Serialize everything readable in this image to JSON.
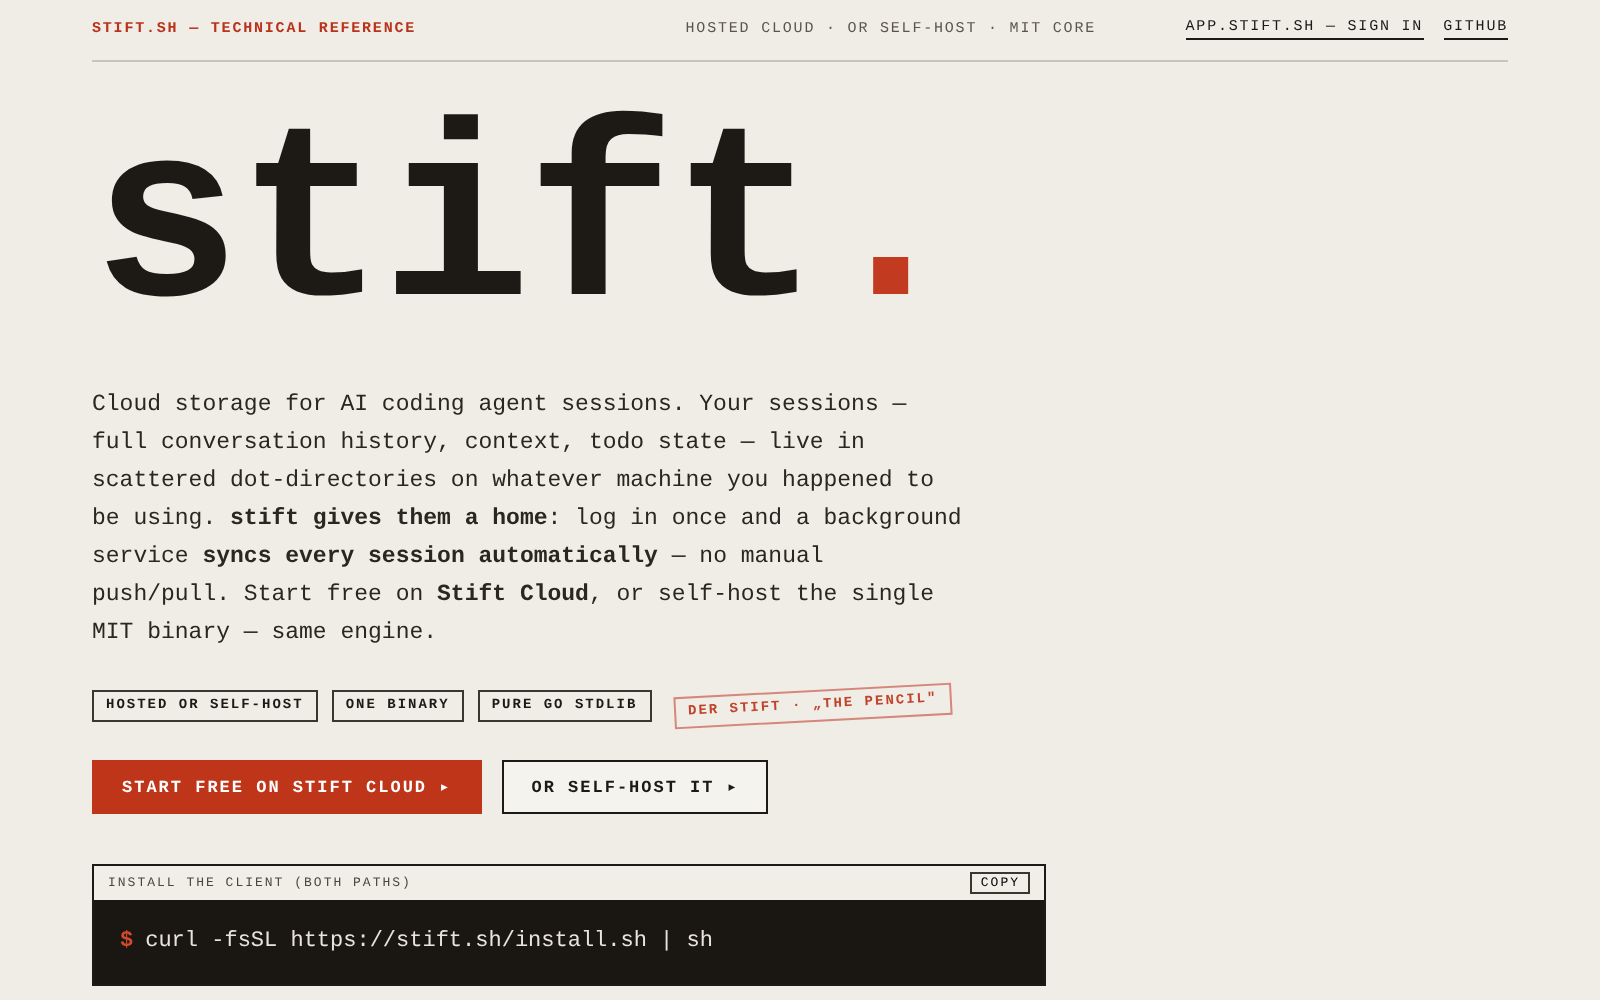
{
  "header": {
    "brand": "STIFT.SH — TECHNICAL REFERENCE",
    "tagline": "HOSTED CLOUD · OR SELF-HOST · MIT CORE",
    "links": [
      {
        "label": "APP.STIFT.SH — SIGN IN"
      },
      {
        "label": "GITHUB"
      }
    ]
  },
  "hero": {
    "title": "stift",
    "title_mark": ".",
    "intro": "Cloud storage for AI coding agent sessions. Your sessions — full conversation history, context, todo state — live in scattered dot-directories on whatever machine you happened to be using. **stift gives them a home**: log in once and a background service **syncs every session automatically** — no manual push/pull. Start free on **Stift Cloud**, or self-host the single MIT binary — same engine."
  },
  "tags": [
    {
      "label": "HOSTED OR SELF-HOST",
      "kind": "plain"
    },
    {
      "label": "ONE BINARY",
      "kind": "plain"
    },
    {
      "label": "PURE GO STDLIB",
      "kind": "plain"
    },
    {
      "label": "DER STIFT · „THE PENCIL\"",
      "kind": "stamp"
    }
  ],
  "buttons": [
    {
      "label": "START FREE ON STIFT CLOUD ▸",
      "kind": "primary"
    },
    {
      "label": "OR SELF-HOST IT ▸",
      "kind": "secondary"
    }
  ],
  "install": {
    "title": "INSTALL THE CLIENT (BOTH PATHS)",
    "copy": "COPY",
    "prompt": "$",
    "command": "curl -fsSL https://stift.sh/install.sh | sh"
  }
}
